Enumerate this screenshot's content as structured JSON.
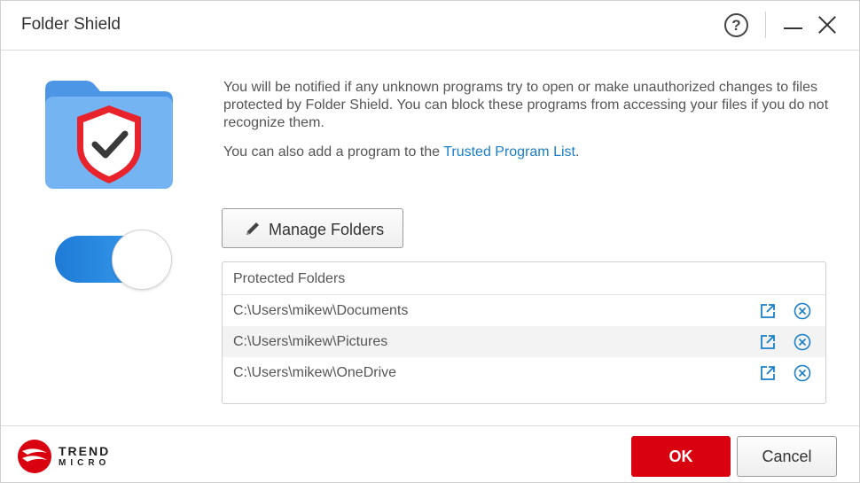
{
  "window": {
    "title": "Folder Shield"
  },
  "titlebar": {
    "help_label": "?",
    "icons": [
      "help-icon",
      "minimize-icon",
      "close-icon"
    ]
  },
  "toggle": {
    "state": "on",
    "color": "#1e7ad6"
  },
  "description": {
    "paragraph1": "You will be notified if any unknown programs try to open or make unauthorized changes to files protected by Folder Shield. You can block these programs from accessing your files if you do not recognize them.",
    "paragraph2_prefix": "You can also add a program to the ",
    "trusted_link": "Trusted Program List",
    "paragraph2_suffix": "."
  },
  "manage_button": {
    "label": "Manage Folders",
    "icon": "pencil-icon"
  },
  "protected_folders": {
    "header": "Protected Folders",
    "rows": [
      {
        "path": "C:\\Users\\mikew\\Documents"
      },
      {
        "path": "C:\\Users\\mikew\\Pictures"
      },
      {
        "path": "C:\\Users\\mikew\\OneDrive"
      }
    ],
    "row_icons": [
      "open-location-icon",
      "remove-icon"
    ]
  },
  "footer": {
    "logo_line1": "TREND",
    "logo_line2": "MICRO",
    "ok_label": "OK",
    "cancel_label": "Cancel"
  },
  "colors": {
    "accent": "#1a7fc9",
    "ok": "#d9000f",
    "shield": "#e8232c",
    "folder": "#6fb1f0"
  }
}
